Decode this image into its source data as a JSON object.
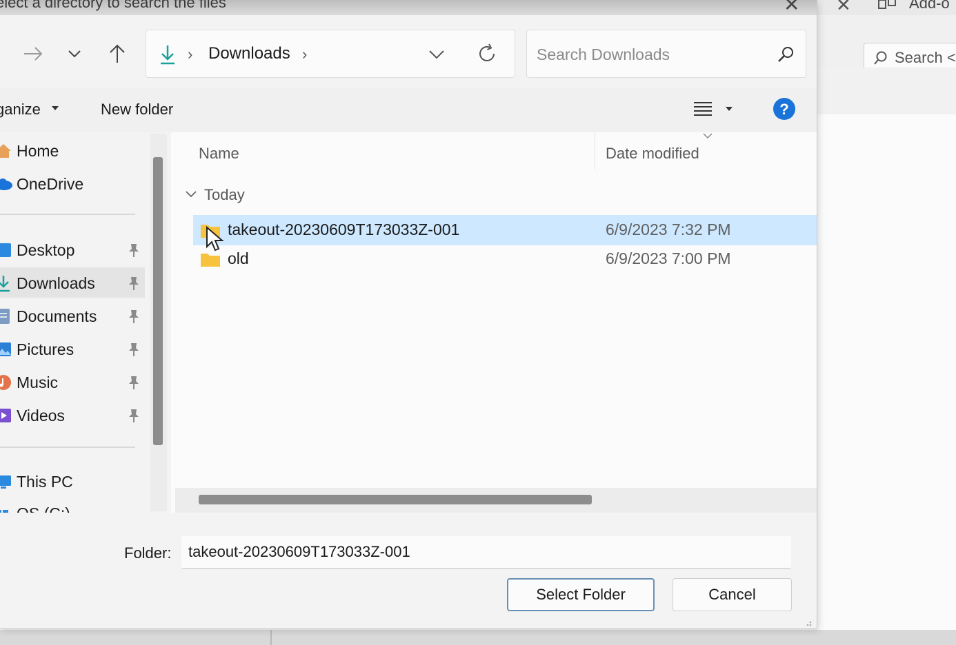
{
  "dialog": {
    "title": "elect a directory to search the files",
    "close_label": "✕"
  },
  "nav_buttons": {
    "forward_icon": "arrow-right-icon",
    "recent_icon": "chevron-down-icon",
    "up_icon": "arrow-up-icon"
  },
  "address_bar": {
    "crumb_icon": "download-icon",
    "separator": "›",
    "crumb": "Downloads"
  },
  "search": {
    "placeholder": "Search Downloads",
    "value": ""
  },
  "command_bar": {
    "organize_label": "ganize",
    "new_folder_label": "New folder"
  },
  "sidebar": {
    "items": [
      {
        "label": "Home",
        "icon": "home-icon",
        "pinned": false
      },
      {
        "label": "OneDrive",
        "icon": "cloud-icon",
        "pinned": false
      },
      {
        "label": "Desktop",
        "icon": "desktop-icon",
        "pinned": true
      },
      {
        "label": "Downloads",
        "icon": "download-icon",
        "pinned": true
      },
      {
        "label": "Documents",
        "icon": "document-icon",
        "pinned": true
      },
      {
        "label": "Pictures",
        "icon": "pictures-icon",
        "pinned": true
      },
      {
        "label": "Music",
        "icon": "music-icon",
        "pinned": true
      },
      {
        "label": "Videos",
        "icon": "video-icon",
        "pinned": true
      },
      {
        "label": "This PC",
        "icon": "computer-icon",
        "pinned": false
      },
      {
        "label": "OS (C:)",
        "icon": "drive-icon",
        "pinned": false
      }
    ],
    "selected": "Downloads"
  },
  "file_list": {
    "columns": [
      "Name",
      "Date modified"
    ],
    "group": "Today",
    "rows": [
      {
        "name": "takeout-20230609T173033Z-001",
        "date": "6/9/2023 7:32 PM",
        "icon": "folder-icon",
        "selected": true
      },
      {
        "name": "old",
        "date": "6/9/2023 7:00 PM",
        "icon": "folder-icon",
        "selected": false
      }
    ]
  },
  "footer": {
    "folder_label": "Folder:",
    "folder_value": "takeout-20230609T173033Z-001",
    "select_button": "Select Folder",
    "cancel_button": "Cancel"
  },
  "background_app": {
    "close_label": "✕",
    "addon_label": "Add-o",
    "search_label": "Search <"
  },
  "colors": {
    "accent": "#0067c0",
    "selection": "#cde8ff",
    "folder": "#f8c33c"
  }
}
